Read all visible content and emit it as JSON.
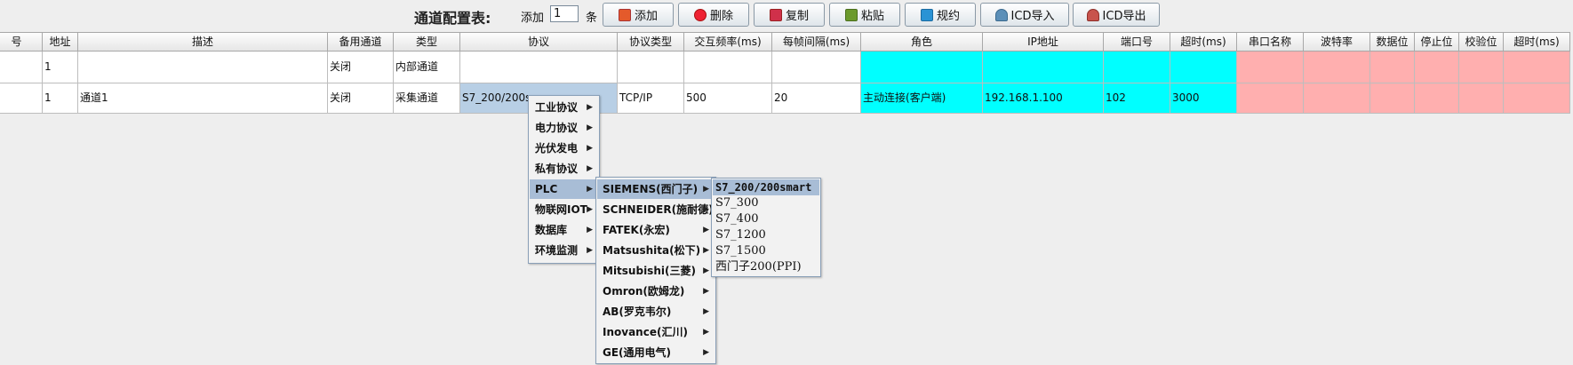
{
  "toolbar": {
    "title": "通道配置表:",
    "add_prefix": "添加",
    "add_count": "1",
    "add_suffix": "条",
    "buttons": {
      "add": "添加",
      "delete": "删除",
      "copy": "复制",
      "paste": "粘贴",
      "rule": "规约",
      "icd_import": "ICD导入",
      "icd_export": "ICD导出"
    },
    "icons": {
      "add": "add-channel-icon",
      "delete": "delete-icon",
      "copy": "copy-icon",
      "paste": "paste-icon",
      "rule": "rule-icon",
      "icd_import": "database-import-icon",
      "icd_export": "database-export-icon"
    }
  },
  "table": {
    "headers": [
      "号",
      "地址",
      "描述",
      "备用通道",
      "类型",
      "协议",
      "协议类型",
      "交互频率(ms)",
      "每帧间隔(ms)",
      "角色",
      "IP地址",
      "端口号",
      "超时(ms)",
      "串口名称",
      "波特率",
      "数据位",
      "停止位",
      "校验位",
      "超时(ms)"
    ],
    "rows": [
      [
        "",
        "1",
        "",
        "关闭",
        "内部通道",
        "",
        "",
        "",
        "",
        "",
        "",
        "",
        "",
        "",
        "",
        "",
        "",
        "",
        ""
      ],
      [
        "",
        "1",
        "通道1",
        "关闭",
        "采集通道",
        "S7_200/200s",
        "TCP/IP",
        "500",
        "20",
        "主动连接(客户端)",
        "192.168.1.100",
        "102",
        "3000",
        "",
        "",
        "",
        "",
        "",
        ""
      ]
    ],
    "colors": {
      "network_params": "#00ffff",
      "serial_params": "#ffafaf",
      "selected_cell": "#b8cfe5"
    }
  },
  "menu_protocol": {
    "items": [
      "工业协议",
      "电力协议",
      "光伏发电",
      "私有协议",
      "PLC",
      "物联网IOT",
      "数据库",
      "环境监测"
    ],
    "highlighted": "PLC"
  },
  "menu_plc": {
    "items": [
      "SIEMENS(西门子)",
      "SCHNEIDER(施耐德)",
      "FATEK(永宏)",
      "Matsushita(松下)",
      "Mitsubishi(三菱)",
      "Omron(欧姆龙)",
      "AB(罗克韦尔)",
      "Inovance(汇川)",
      "GE(通用电气)"
    ],
    "highlighted": "SIEMENS(西门子)"
  },
  "menu_siemens": {
    "items": [
      "S7_200/200smart",
      "S7_300",
      "S7_400",
      "S7_1200",
      "S7_1500",
      "西门子200(PPI)"
    ],
    "highlighted": "S7_200/200smart"
  }
}
